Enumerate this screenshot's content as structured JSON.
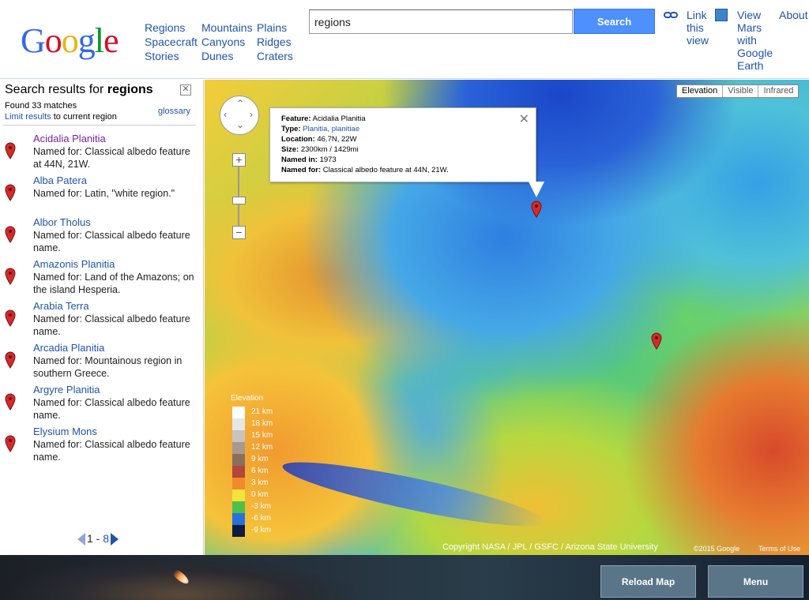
{
  "header": {
    "logo_letters": [
      {
        "ch": "G",
        "color": "#3369e8"
      },
      {
        "ch": "o",
        "color": "#d50f25"
      },
      {
        "ch": "o",
        "color": "#eeb211"
      },
      {
        "ch": "g",
        "color": "#3369e8"
      },
      {
        "ch": "l",
        "color": "#009925"
      },
      {
        "ch": "e",
        "color": "#d50f25"
      }
    ],
    "nav_col1": [
      "Regions",
      "Spacecraft",
      "Stories"
    ],
    "nav_col2": [
      "Mountains",
      "Canyons",
      "Dunes"
    ],
    "nav_col3": [
      "Plains",
      "Ridges",
      "Craters"
    ],
    "search_value": "regions",
    "search_button": "Search",
    "link_view": "Link this view",
    "view_earth": "View Mars with Google Earth",
    "about": "About",
    "link_icon": "link-icon",
    "earth_icon": "google-earth-icon"
  },
  "sidebar": {
    "title_prefix": "Search results for",
    "title_query": "regions",
    "found": "Found 33 matches",
    "limit_link": "Limit results",
    "limit_rest": "to current region",
    "glossary": "glossary",
    "results": [
      {
        "title": "Acidalia Planitia",
        "desc": "Named for: Classical albedo feature at 44N, 21W."
      },
      {
        "title": "Alba Patera",
        "desc": "Named for: Latin, \"white region.\""
      },
      {
        "title": "Albor Tholus",
        "desc": "Named for: Classical albedo feature name."
      },
      {
        "title": "Amazonis Planitia",
        "desc": "Named for: Land of the Amazons; on the island Hesperia."
      },
      {
        "title": "Arabia Terra",
        "desc": "Named for: Classical albedo feature name."
      },
      {
        "title": "Arcadia Planitia",
        "desc": "Named for: Mountainous region in southern Greece."
      },
      {
        "title": "Argyre Planitia",
        "desc": "Named for: Classical albedo feature name."
      },
      {
        "title": "Elysium Mons",
        "desc": "Named for: Classical albedo feature name."
      }
    ],
    "pager_text": "1 - ",
    "pager_current": "8"
  },
  "map": {
    "types": [
      "Elevation",
      "Visible",
      "Infrared"
    ],
    "info": {
      "feature_label": "Feature:",
      "feature": "Acidalia Planitia",
      "type_label": "Type:",
      "type": "Planitia, planitiae",
      "location_label": "Location:",
      "location": "46.7N, 22W",
      "size_label": "Size:",
      "size": "2300km / 1429mi",
      "named_in_label": "Named in:",
      "named_in": "1973",
      "named_for_label": "Named for:",
      "named_for": "Classical albedo feature at 44N, 21W."
    },
    "legend_title": "Elevation",
    "legend": [
      {
        "label": "21 km",
        "color": "#ffffff"
      },
      {
        "label": "18 km",
        "color": "#e6e6e6"
      },
      {
        "label": "15 km",
        "color": "#c9c3bf"
      },
      {
        "label": "12 km",
        "color": "#a89a8f"
      },
      {
        "label": "9 km",
        "color": "#8a6f5c"
      },
      {
        "label": "6 km",
        "color": "#b2463a"
      },
      {
        "label": "3 km",
        "color": "#f08a2a"
      },
      {
        "label": "0 km",
        "color": "#f5e23a"
      },
      {
        "label": "-3 km",
        "color": "#4ec04a"
      },
      {
        "label": "-6 km",
        "color": "#2b6fd8"
      },
      {
        "label": "-9 km",
        "color": "#121a40"
      }
    ],
    "copyright": "Copyright NASA / JPL / GSFC / Arizona State University",
    "gcopy": "©2015 Google",
    "terms": "Terms of Use"
  },
  "footer": {
    "reload": "Reload Map",
    "menu": "Menu"
  }
}
